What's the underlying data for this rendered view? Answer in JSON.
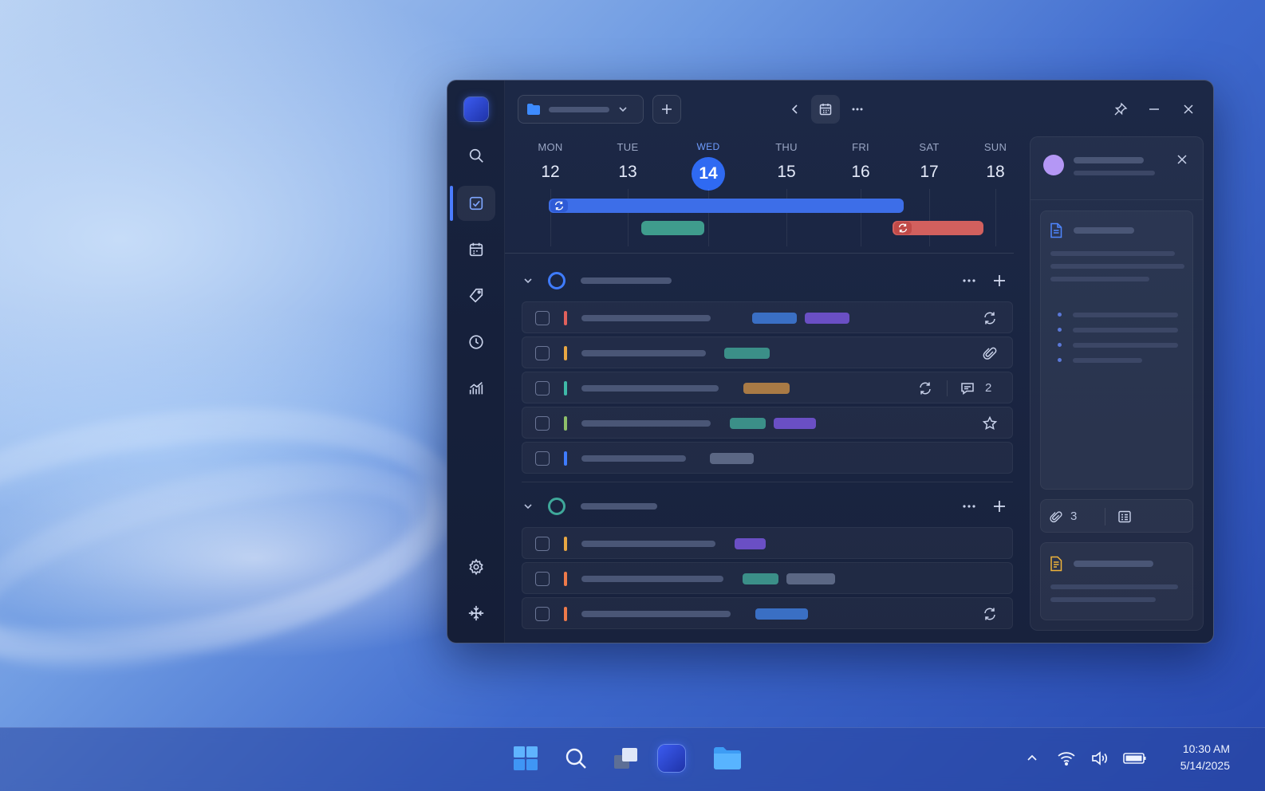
{
  "window": {
    "week": [
      {
        "name": "MON",
        "num": "12"
      },
      {
        "name": "TUE",
        "num": "13"
      },
      {
        "name": "WED",
        "num": "14",
        "today": true
      },
      {
        "name": "THU",
        "num": "15"
      },
      {
        "name": "FRI",
        "num": "16"
      },
      {
        "name": "SAT",
        "num": "17"
      },
      {
        "name": "SUN",
        "num": "18"
      }
    ],
    "sections": [
      {
        "ring_color": "#3f7cff"
      },
      {
        "ring_color": "#3fa89a"
      }
    ],
    "task_row_3_comment_count": "2",
    "panel": {
      "attachments_count": "3"
    }
  },
  "taskbar": {
    "time": "10:30 AM",
    "date": "5/14/2025"
  },
  "colors": {
    "accent": "#2f6af2",
    "event_blue": "#3d6ee8",
    "event_teal": "#3f9c8d",
    "event_red": "#d2605e",
    "tag_blue": "#3a6fc4",
    "tag_purple": "#6a4fc4",
    "tag_teal": "#3b8f88",
    "tag_orange": "#a97a45",
    "tag_gray": "#5b6784"
  }
}
